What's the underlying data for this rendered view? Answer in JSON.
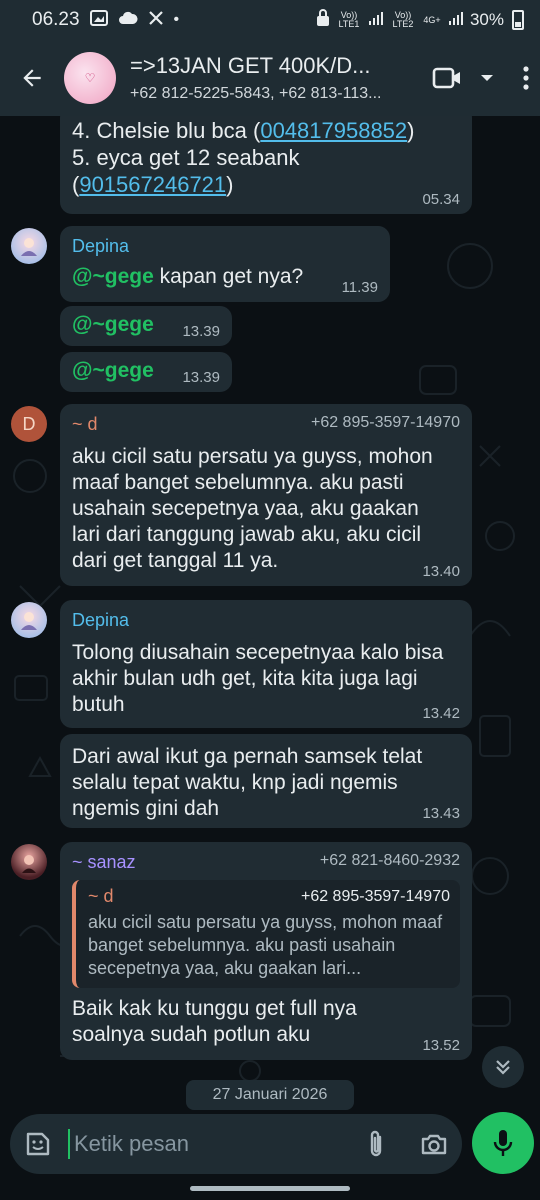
{
  "status_bar": {
    "time": "06.23",
    "sim1": "Vo)) LTE1",
    "sim2": "Vo)) LTE2",
    "net": "4G+",
    "battery": "30%"
  },
  "header": {
    "title": "=>13JAN GET 400K/D...",
    "subtitle": "+62 812-5225-5843, +62 813-113...",
    "avatar_text": "♡"
  },
  "messages": {
    "m1": {
      "line4": "4. Chelsie blu bca (",
      "link4": "004817958852",
      "line4_end": ")",
      "line5": "5. eyca get 12 seabank",
      "open5": "(",
      "link5": "901567246721",
      "line5_end": ")",
      "time": "05.34"
    },
    "m2": {
      "sender": "Depina",
      "mention": "@~gege",
      "text": " kapan get nya?",
      "time": "11.39"
    },
    "m3": {
      "mention": "@~gege",
      "time": "13.39"
    },
    "m4": {
      "mention": "@~gege",
      "time": "13.39"
    },
    "m5": {
      "avatar": "D",
      "sender": "~ d",
      "phone": "+62 895-3597-14970",
      "text": "aku cicil satu persatu ya guyss, mohon maaf banget sebelumnya. aku pasti usahain secepetnya yaa, aku gaakan lari dari tanggung jawab aku, aku cicil dari get tanggal 11 ya.",
      "time": "13.40"
    },
    "m6": {
      "sender": "Depina",
      "text": "Tolong diusahain secepetnyaa kalo bisa akhir bulan udh get, kita kita juga lagi butuh",
      "time": "13.42"
    },
    "m7": {
      "text": "Dari awal ikut ga pernah samsek telat selalu tepat waktu, knp jadi ngemis ngemis gini dah",
      "time": "13.43"
    },
    "m8": {
      "sender": "~ sanaz",
      "phone": "+62 821-8460-2932",
      "quote_sender": "~ d",
      "quote_phone": "+62 895-3597-14970",
      "quote_text": "aku cicil satu persatu ya guyss, mohon maaf banget sebelumnya. aku pasti usahain secepetnya yaa, aku gaakan lari...",
      "text": "Baik kak ku tunggu get full nya soalnya sudah potlun aku",
      "time": "13.52"
    }
  },
  "date_chip": "27 Januari 2026",
  "input": {
    "placeholder": "Ketik pesan"
  },
  "colors": {
    "accent": "#21c063",
    "header_bg": "#1f2c33",
    "bubble_bg": "#202c33",
    "chat_bg": "#0b1014",
    "sender_depina": "#53bdeb",
    "sender_d": "#e1886b",
    "sender_sanaz": "#a791ff",
    "link": "#53bdeb"
  },
  "icons": [
    "back-arrow-icon",
    "video-call-icon",
    "dropdown-caret-icon",
    "more-vert-icon",
    "double-chevron-down-icon",
    "sticker-icon",
    "attach-icon",
    "camera-icon",
    "mic-icon"
  ]
}
